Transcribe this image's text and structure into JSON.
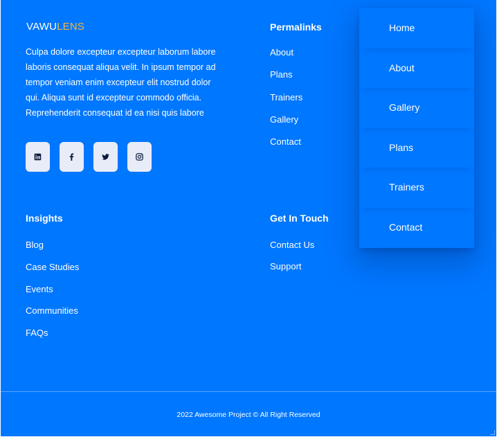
{
  "brand": {
    "part1": "VAWU",
    "part2": "LENS",
    "accent_color": "#f6b63e"
  },
  "about": {
    "text": "Culpa dolore excepteur excepteur laborum labore laboris consequat aliqua velit. In ipsum tempor ad tempor veniam enim excepteur elit nostrud dolor qui. Aliqua sunt id excepteur commodo officia. Reprehenderit consequat id ea nisi quis labore"
  },
  "socials": [
    {
      "icon": "linkedin-icon"
    },
    {
      "icon": "facebook-icon"
    },
    {
      "icon": "twitter-icon"
    },
    {
      "icon": "instagram-icon"
    }
  ],
  "permalinks": {
    "title": "Permalinks",
    "items": [
      "About",
      "Plans",
      "Trainers",
      "Gallery",
      "Contact"
    ]
  },
  "insights": {
    "title": "Insights",
    "items": [
      "Blog",
      "Case Studies",
      "Events",
      "Communities",
      "FAQs"
    ]
  },
  "get_in_touch": {
    "title": "Get In Touch",
    "items": [
      "Contact Us",
      "Support"
    ]
  },
  "copyright": "2022 Awesome Project © All Right Reserved",
  "dropdown_menu": {
    "items": [
      "Home",
      "About",
      "Gallery",
      "Plans",
      "Trainers",
      "Contact"
    ]
  },
  "colors": {
    "background": "#0077ff",
    "text": "#ffffff",
    "social_bg": "#e8ecf8"
  }
}
